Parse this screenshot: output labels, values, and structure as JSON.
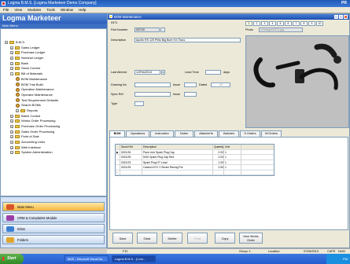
{
  "window": {
    "title": "Logma B.M.S.  [Logma Marketeer Demo Company]",
    "brand": "PR"
  },
  "menu": [
    "File",
    "View",
    "Modules",
    "Tools",
    "Window",
    "Help"
  ],
  "app_header": "Logma Marketeer",
  "main_menu_label": "Main Menu",
  "tree": [
    {
      "label": "B.M.S.",
      "level": 0,
      "kind": "root"
    },
    {
      "label": "Sales Ledger",
      "level": 1,
      "kind": "folder"
    },
    {
      "label": "Purchase Ledger",
      "level": 1,
      "kind": "folder"
    },
    {
      "label": "Nominal Ledger",
      "level": 1,
      "kind": "folder"
    },
    {
      "label": "Bank",
      "level": 1,
      "kind": "folder"
    },
    {
      "label": "Stock Control",
      "level": 1,
      "kind": "folder"
    },
    {
      "label": "Bill of Materials",
      "level": 1,
      "kind": "folder",
      "expanded": true
    },
    {
      "label": "BOM Maintenance",
      "level": 2,
      "kind": "item"
    },
    {
      "label": "BOM Trial Build",
      "level": 2,
      "kind": "item"
    },
    {
      "label": "Operation Maintenance",
      "level": 2,
      "kind": "item"
    },
    {
      "label": "Operator Maintenance",
      "level": 2,
      "kind": "item"
    },
    {
      "label": "Test Requirement Defaults",
      "level": 2,
      "kind": "item"
    },
    {
      "label": "Search BOMs",
      "level": 2,
      "kind": "item"
    },
    {
      "label": "Reports",
      "level": 2,
      "kind": "folder"
    },
    {
      "label": "Batch Control",
      "level": 1,
      "kind": "folder"
    },
    {
      "label": "Works Order Processing",
      "level": 1,
      "kind": "folder"
    },
    {
      "label": "Purchase Order Processing",
      "level": 1,
      "kind": "folder"
    },
    {
      "label": "Sales Order Processing",
      "level": 1,
      "kind": "folder"
    },
    {
      "label": "Point of Sale",
      "level": 1,
      "kind": "folder"
    },
    {
      "label": "Accounting Links",
      "level": 1,
      "kind": "folder"
    },
    {
      "label": "Web Interface",
      "level": 1,
      "kind": "folder"
    },
    {
      "label": "System Administration",
      "level": 1,
      "kind": "folder"
    }
  ],
  "nav_buttons": [
    {
      "label": "Main Menu",
      "active": true,
      "color": "#d9552a"
    },
    {
      "label": "CRM & Complaints Module",
      "active": false,
      "color": "#9b3fa8"
    },
    {
      "label": "Inbox",
      "active": false,
      "color": "#3b7fd4"
    },
    {
      "label": "Folders",
      "active": false,
      "color": "#e0a52a"
    }
  ],
  "child_window": {
    "title": "BOM Maintenance"
  },
  "form": {
    "code": "0371",
    "part_number_label": "Part Number",
    "part_number": "0371/0",
    "description_label": "Description",
    "description": "Apollo RS 125 Pilito Big Bore Kit 70ccs",
    "last_altered_label": "Last Altered",
    "last_altered": "12/Feb/2013",
    "lead_time_label": "Lead Time",
    "lead_time_unit": "days",
    "drawing_no_label": "Drawing No",
    "issue_label": "Issue",
    "dated_label": "Dated",
    "dated": "/ /",
    "spec_ref_label": "Spec Ref",
    "spec_issue_label": "Issue",
    "type_label": "Type",
    "photo_label": "Photo",
    "photo_path": "c:\\images\\0371.jpg",
    "photo_tabs": [
      "1",
      "2",
      "3",
      "4",
      "5",
      "6",
      "7",
      "8",
      "9",
      "10"
    ]
  },
  "tabs": [
    "BOM",
    "Operations",
    "Instruction",
    "Notes",
    "Attachm'ts",
    "Batches",
    "S.Orders",
    "W.Orders"
  ],
  "grid": {
    "columns": [
      "Stock Ref",
      "Description",
      "Quantity",
      "Unit"
    ],
    "rows": [
      {
        "ref": "0021/26",
        "desc": "Pace Line Spark Plug Cap",
        "qty": "2.00",
        "unit": "1"
      },
      {
        "ref": "0021/25",
        "desc": "NGK Spark Plug Cap Red",
        "qty": "2.00",
        "unit": "1"
      },
      {
        "ref": "0021/23",
        "desc": "Spark Plug HT Lead",
        "qty": "1.00",
        "unit": "1"
      },
      {
        "ref": "0021/25",
        "desc": "Castrol A747 2 Stroke Racing Pre",
        "qty": "2.50",
        "unit": "1"
      }
    ]
  },
  "buttons": [
    {
      "label": "Save",
      "enabled": true
    },
    {
      "label": "Clear",
      "enabled": true
    },
    {
      "label": "Delete",
      "enabled": true
    },
    {
      "label": "Print",
      "enabled": false
    },
    {
      "label": "Copy",
      "enabled": true
    },
    {
      "label": "New Works Order",
      "enabled": true
    }
  ],
  "status": {
    "f_key": "F10",
    "group": "Group: 1",
    "location": "Location:",
    "date": "07/06/2013",
    "caps": "CAPS",
    "num": "NUM"
  },
  "taskbar": {
    "start": "Start",
    "tasks": [
      "BMS - Microsoft Visual Ba...",
      "Logma B.M.S. - [Lom..."
    ],
    "clock": "PM"
  }
}
